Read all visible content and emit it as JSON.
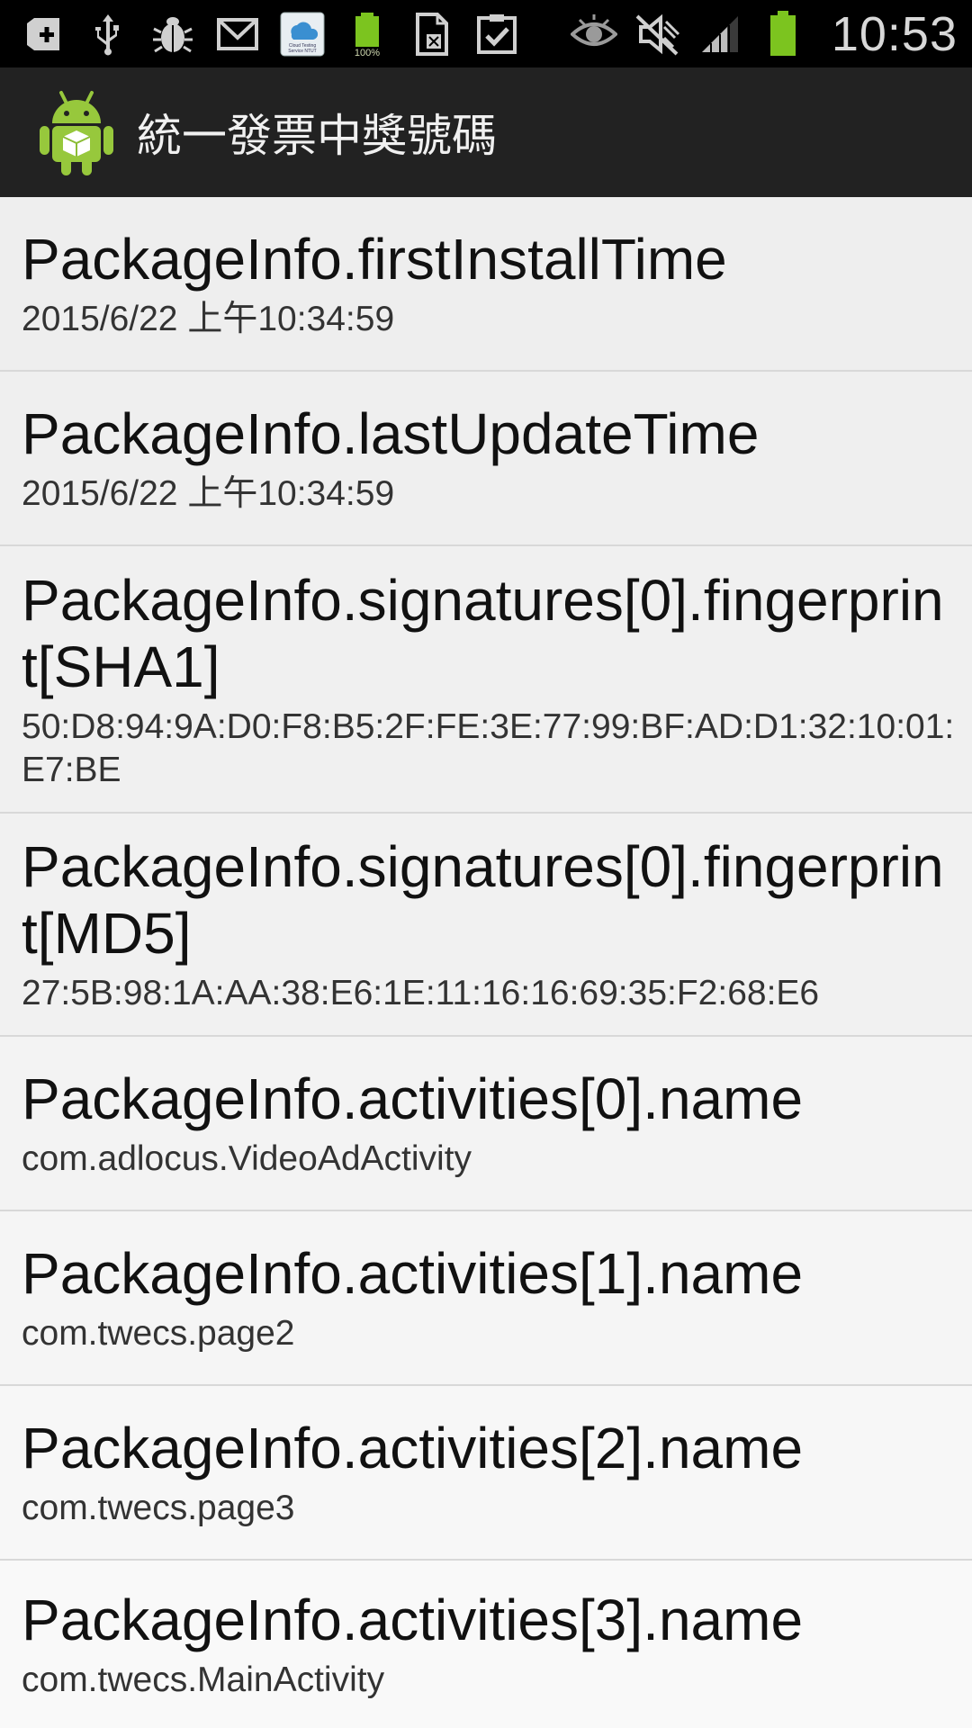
{
  "status_bar": {
    "left_icons": [
      "add-icon",
      "usb-icon",
      "bug-icon",
      "gmail-icon",
      "cloud-app-icon",
      "battery-full-icon",
      "document-icon",
      "clipboard-check-icon"
    ],
    "cloud_app_text": "Cloud Testing Service NTUT",
    "battery_small_label": "100%",
    "right_icons": [
      "eye-icon",
      "mute-icon",
      "signal-icon",
      "battery-icon"
    ],
    "time": "10:53"
  },
  "action_bar": {
    "logo_icon": "android-app-icon",
    "title": "統一發票中獎號碼"
  },
  "list": {
    "items": [
      {
        "title": "PackageInfo.firstInstallTime",
        "value": "2015/6/22 上午10:34:59"
      },
      {
        "title": "PackageInfo.lastUpdateTime",
        "value": "2015/6/22 上午10:34:59"
      },
      {
        "title": "PackageInfo.signatures[0].fingerprint[SHA1]",
        "value": "50:D8:94:9A:D0:F8:B5:2F:FE:3E:77:99:BF:AD:D1:32:10:01:E7:BE"
      },
      {
        "title": "PackageInfo.signatures[0].fingerprint[MD5]",
        "value": "27:5B:98:1A:AA:38:E6:1E:11:16:16:69:35:F2:68:E6"
      },
      {
        "title": "PackageInfo.activities[0].name",
        "value": "com.adlocus.VideoAdActivity"
      },
      {
        "title": "PackageInfo.activities[1].name",
        "value": "com.twecs.page2"
      },
      {
        "title": "PackageInfo.activities[2].name",
        "value": "com.twecs.page3"
      },
      {
        "title": "PackageInfo.activities[3].name",
        "value": "com.twecs.MainActivity"
      }
    ]
  },
  "colors": {
    "status_bar_bg": "#000000",
    "action_bar_bg": "#222222",
    "list_bg": "#f3f3f3",
    "battery_green": "#7cc41f"
  }
}
